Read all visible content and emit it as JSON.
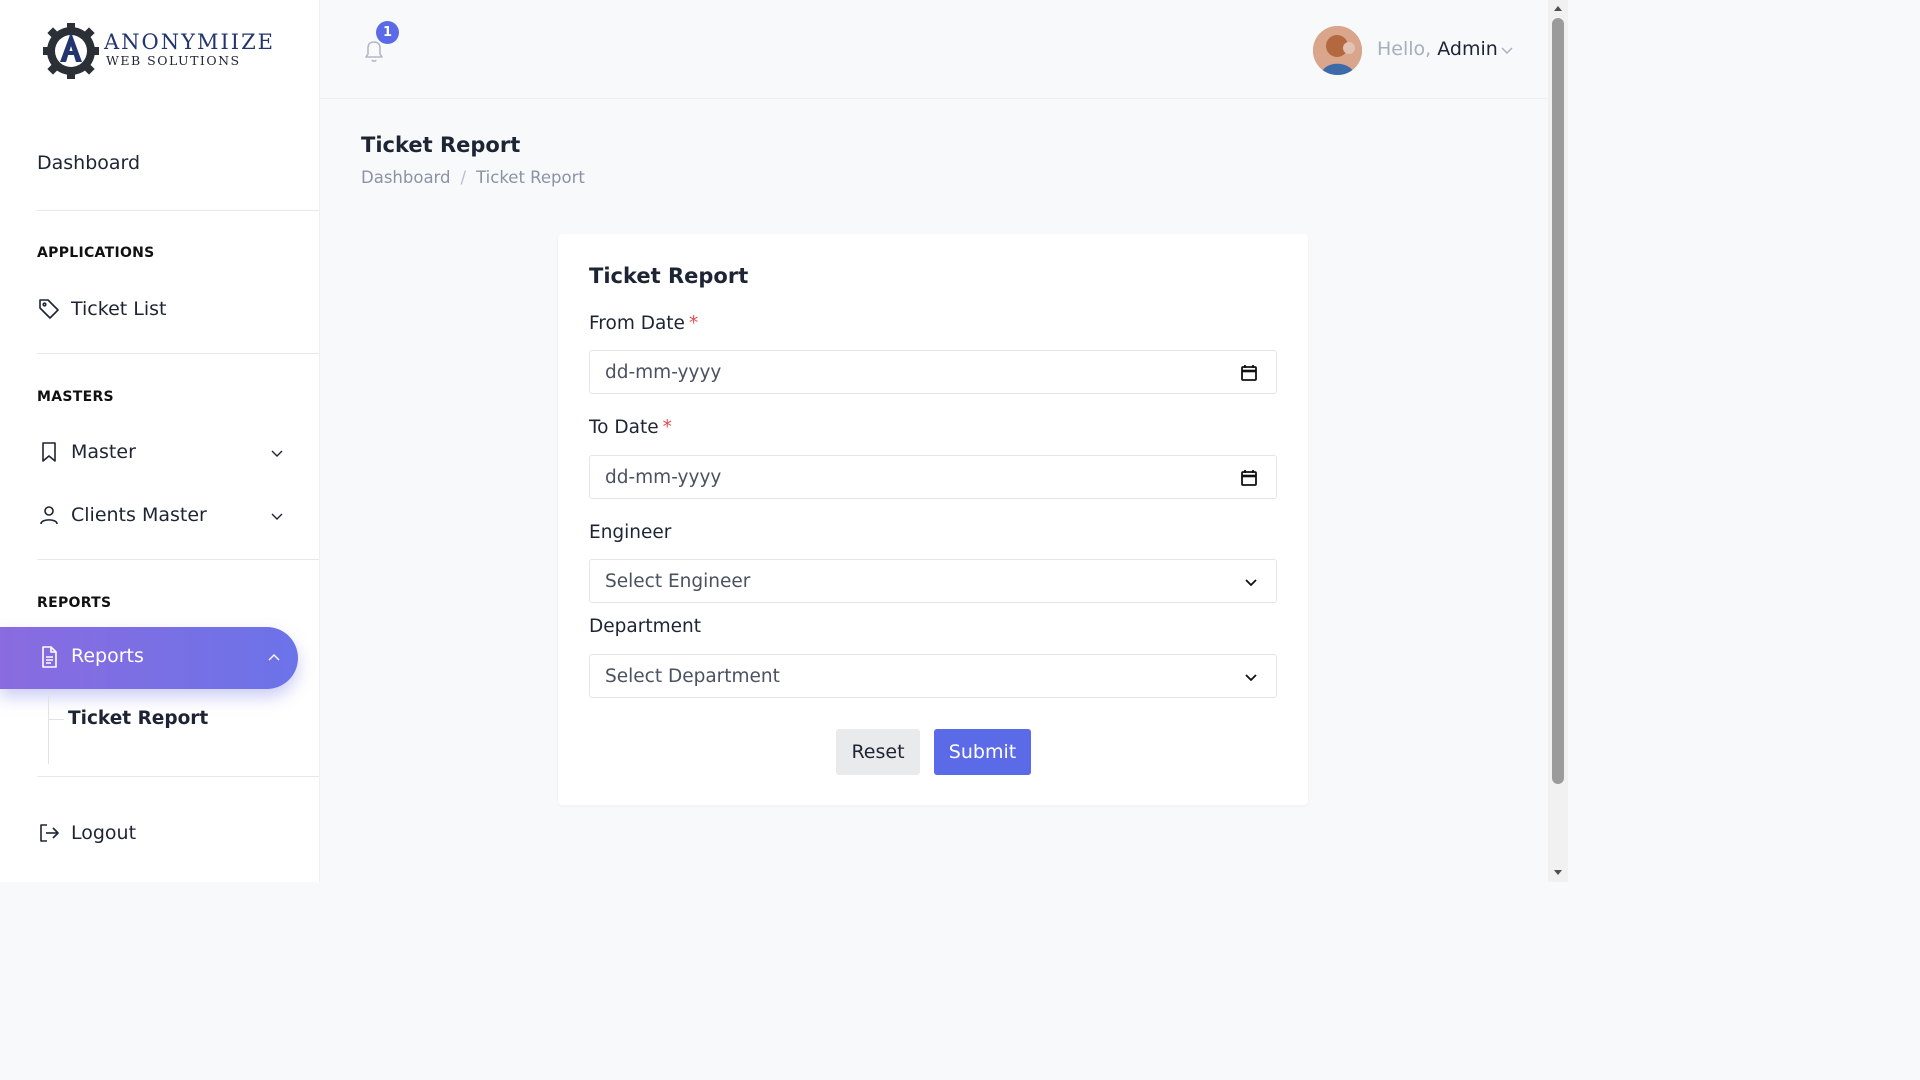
{
  "brand": {
    "name": "ANONYMIIZE",
    "tagline": "WEB SOLUTIONS"
  },
  "sidebar": {
    "dashboard": "Dashboard",
    "sections": {
      "applications": "APPLICATIONS",
      "masters": "MASTERS",
      "reports": "REPORTS"
    },
    "items": {
      "ticket_list": "Ticket List",
      "master": "Master",
      "clients_master": "Clients Master",
      "reports": "Reports",
      "ticket_report": "Ticket Report",
      "logout": "Logout"
    }
  },
  "header": {
    "notification_count": "1",
    "greeting": "Hello,",
    "user_name": "Admin"
  },
  "page": {
    "title": "Ticket Report",
    "breadcrumb": [
      "Dashboard",
      "Ticket Report"
    ]
  },
  "form": {
    "title": "Ticket Report",
    "from_date": {
      "label": "From Date",
      "required_mark": "*",
      "placeholder": "dd-mm-yyyy"
    },
    "to_date": {
      "label": "To Date",
      "required_mark": "*",
      "placeholder": "dd-mm-yyyy"
    },
    "engineer": {
      "label": "Engineer",
      "value": "Select Engineer"
    },
    "department": {
      "label": "Department",
      "value": "Select Department"
    },
    "reset_label": "Reset",
    "submit_label": "Submit"
  },
  "colors": {
    "accent": "#5b6be8",
    "active_gradient_start": "#8a6be0",
    "active_gradient_end": "#6c73e8",
    "required": "#e5484d"
  }
}
